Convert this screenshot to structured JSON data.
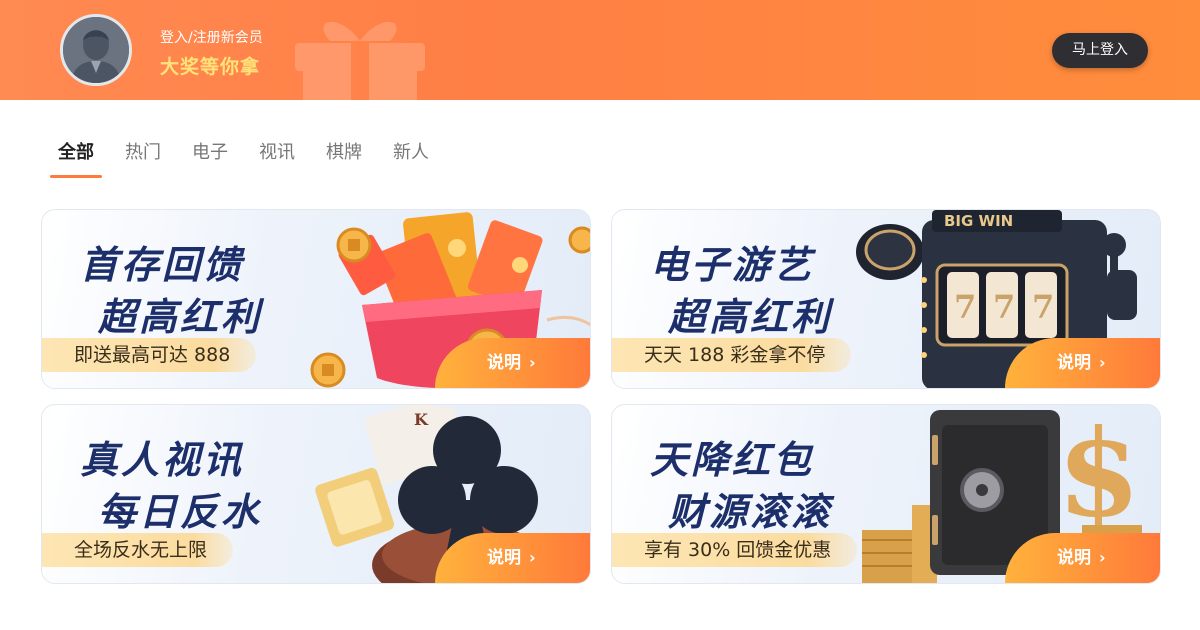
{
  "header": {
    "login_hint": "登入/注册新会员",
    "prize_text": "大奖等你拿",
    "login_button": "马上登入",
    "colors": {
      "gradient_start": "#ff8a52",
      "gradient_end": "#ff8d3c",
      "prize": "#ffe27a",
      "button": "#2f2f33"
    }
  },
  "tabs": [
    {
      "label": "全部",
      "active": true
    },
    {
      "label": "热门",
      "active": false
    },
    {
      "label": "电子",
      "active": false
    },
    {
      "label": "视讯",
      "active": false
    },
    {
      "label": "棋牌",
      "active": false
    },
    {
      "label": "新人",
      "active": false
    }
  ],
  "cards": [
    {
      "title_line1": "首存回馈",
      "title_line2": "超高红利",
      "subtitle": "即送最高可达 888",
      "button": "说明",
      "art": "red-envelopes-gift-box"
    },
    {
      "title_line1": "电子游艺",
      "title_line2": "超高红利",
      "subtitle": "天天 188 彩金拿不停",
      "button": "说明",
      "art": "big-win-slot-machine"
    },
    {
      "title_line1": "真人视讯",
      "title_line2": "每日反水",
      "subtitle": "全场反水无上限",
      "button": "说明",
      "art": "playing-cards-club-chip"
    },
    {
      "title_line1": "天降红包",
      "title_line2": "财源滚滚",
      "subtitle": "享有 30% 回馈金优惠",
      "button": "说明",
      "art": "safe-dollar-coins"
    }
  ],
  "accent_color": "#ff7a3d"
}
